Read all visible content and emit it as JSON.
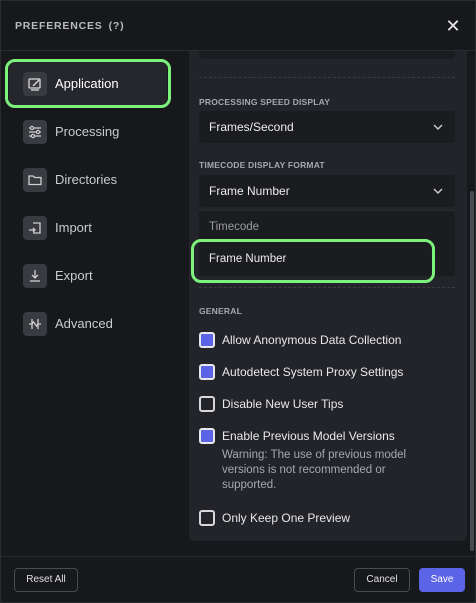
{
  "header": {
    "title": "PREFERENCES",
    "help": "(?)",
    "close_icon": "close-icon"
  },
  "sidebar": {
    "items": [
      {
        "label": "Application",
        "icon": "application-icon",
        "active": true
      },
      {
        "label": "Processing",
        "icon": "sliders-icon",
        "active": false
      },
      {
        "label": "Directories",
        "icon": "folder-icon",
        "active": false
      },
      {
        "label": "Import",
        "icon": "import-icon",
        "active": false
      },
      {
        "label": "Export",
        "icon": "export-icon",
        "active": false
      },
      {
        "label": "Advanced",
        "icon": "advanced-icon",
        "active": false
      }
    ]
  },
  "content": {
    "processing_speed": {
      "label": "PROCESSING SPEED DISPLAY",
      "value": "Frames/Second"
    },
    "timecode": {
      "label": "TIMECODE DISPLAY FORMAT",
      "value": "Frame Number",
      "options": [
        "Timecode",
        "Frame Number"
      ]
    },
    "general": {
      "label": "GENERAL",
      "checkboxes": [
        {
          "label": "Allow Anonymous Data Collection",
          "checked": true
        },
        {
          "label": "Autodetect System Proxy Settings",
          "checked": true
        },
        {
          "label": "Disable New User Tips",
          "checked": false
        },
        {
          "label": "Enable Previous Model Versions",
          "checked": true
        },
        {
          "label": "Only Keep One Preview",
          "checked": false
        }
      ],
      "warning": "Warning: The use of previous model versions is not recommended or supported."
    }
  },
  "footer": {
    "reset_label": "Reset All",
    "cancel_label": "Cancel",
    "save_label": "Save"
  },
  "colors": {
    "accent": "#5b63e6",
    "highlight": "#7cf27c",
    "background": "#17181b",
    "panel": "#232429"
  }
}
